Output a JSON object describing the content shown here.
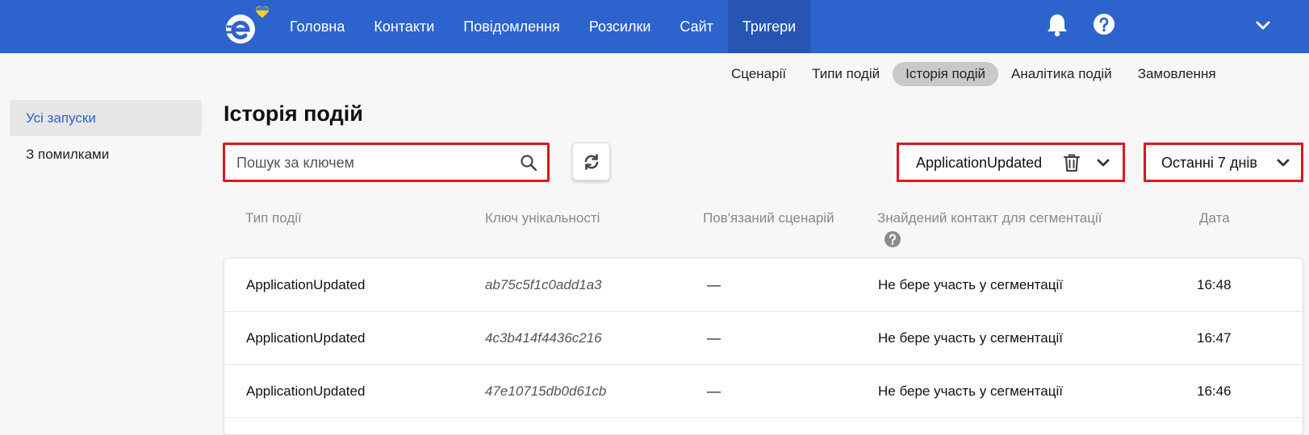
{
  "nav": {
    "items": [
      {
        "label": "Головна"
      },
      {
        "label": "Контакти"
      },
      {
        "label": "Повідомлення"
      },
      {
        "label": "Розсилки"
      },
      {
        "label": "Сайт"
      },
      {
        "label": "Тригери",
        "active": true
      }
    ]
  },
  "subnav": {
    "items": [
      {
        "label": "Сценарії"
      },
      {
        "label": "Типи подій"
      },
      {
        "label": "Історія подій",
        "active": true
      },
      {
        "label": "Аналітика подій"
      },
      {
        "label": "Замовлення"
      }
    ]
  },
  "sidebar": {
    "items": [
      {
        "label": "Усі запуски",
        "active": true
      },
      {
        "label": "З помилками"
      }
    ]
  },
  "page": {
    "title": "Історія подій"
  },
  "search": {
    "placeholder": "Пошук за ключем"
  },
  "filters": {
    "event_type": "ApplicationUpdated",
    "period": "Останні 7 днів"
  },
  "table": {
    "columns": {
      "event_type": "Тип події",
      "key": "Ключ унікальності",
      "scenario": "Пов'язаний сценарій",
      "contact": "Знайдений контакт для сегментації",
      "date": "Дата"
    },
    "rows": [
      {
        "event_type": "ApplicationUpdated",
        "key": "ab75c5f1c0add1a3",
        "scenario": "—",
        "contact": "Не бере участь у сегментації",
        "date": "16:48"
      },
      {
        "event_type": "ApplicationUpdated",
        "key": "4c3b414f4436c216",
        "scenario": "—",
        "contact": "Не бере участь у сегментації",
        "date": "16:47"
      },
      {
        "event_type": "ApplicationUpdated",
        "key": "47e10715db0d61cb",
        "scenario": "—",
        "contact": "Не бере участь у сегментації",
        "date": "16:46"
      }
    ]
  },
  "colors": {
    "topbar": "#2d63cc",
    "accent": "#2d63cc",
    "highlight_border": "#e0161f"
  }
}
